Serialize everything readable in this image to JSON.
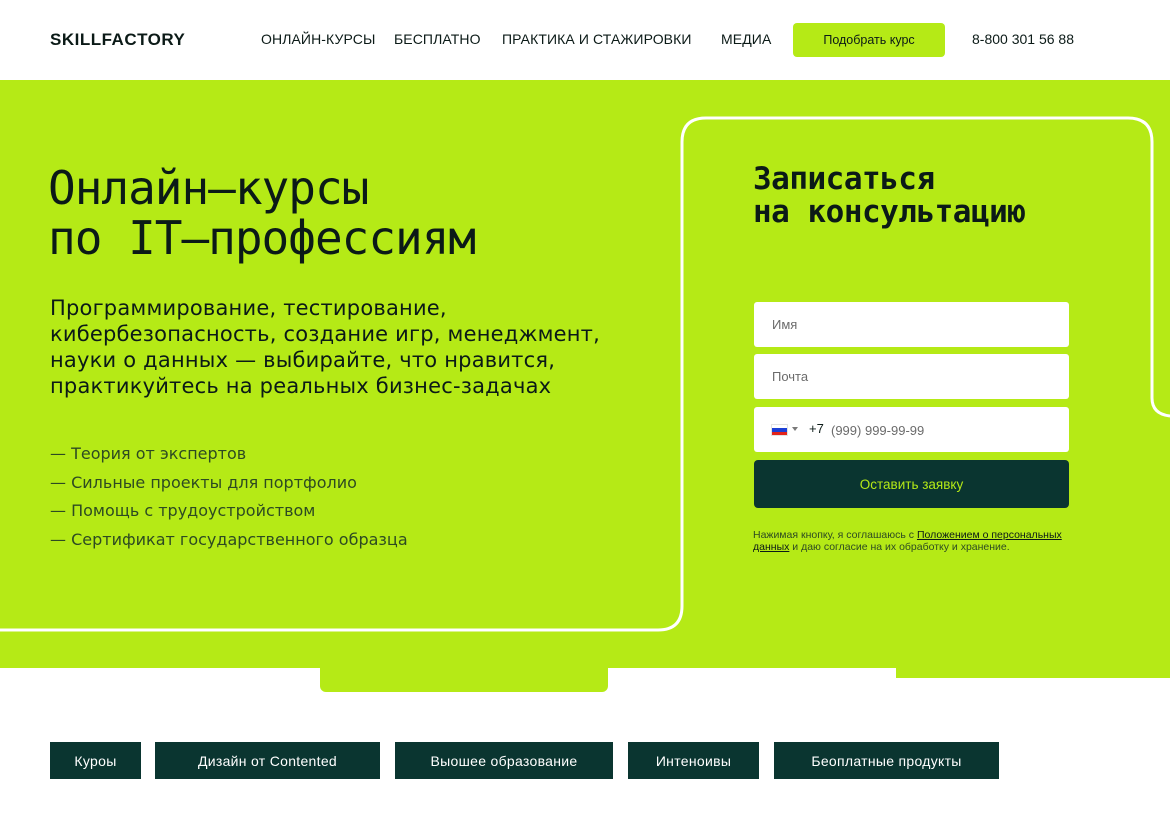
{
  "header": {
    "logo": "SKILLFACTORY",
    "nav": [
      "ОНЛАЙН-КУРСЫ",
      "БЕСПЛАТНО",
      "ПРАКТИКА И СТАЖИРОВКИ",
      "МЕДИА"
    ],
    "cta_label": "Подобрать курс",
    "phone": "8-800 301 56 88"
  },
  "hero": {
    "title_lines": [
      "Онлайн–курсы",
      "по IT–профессиям"
    ],
    "subtitle": "Программирование, тестирование, кибербезопасность, создание игр, менеджмент, науки о данных — выбирайте, что нравится, практикуйтесь на реальных бизнес-задачах",
    "features": [
      "— Теория от экспертов",
      "— Сильные проекты для портфолио",
      "— Помощь с трудоустройством",
      "— Сертификат государственного образца"
    ]
  },
  "form": {
    "title_lines": [
      "Записаться",
      "на консультацию"
    ],
    "name_placeholder": "Имя",
    "email_placeholder": "Почта",
    "phone_code": "+7",
    "phone_placeholder": "(999) 999-99-99",
    "submit_label": "Оставить заявку",
    "consent_prefix": "Нажимая кнопку, я соглашаюсь с ",
    "consent_link": "Положением о персональных данных",
    "consent_suffix": " и даю согласие на их обработку и хранение."
  },
  "categories": [
    "Куроы",
    "Дизайн от Contented",
    "Выошее образование",
    "Интеноивы",
    "Беоплатные продукты"
  ],
  "colors": {
    "accent": "#b5ea16",
    "dark": "#0a3530"
  },
  "icons": {
    "flag": "russia-flag-icon",
    "caret": "chevron-down-icon"
  }
}
